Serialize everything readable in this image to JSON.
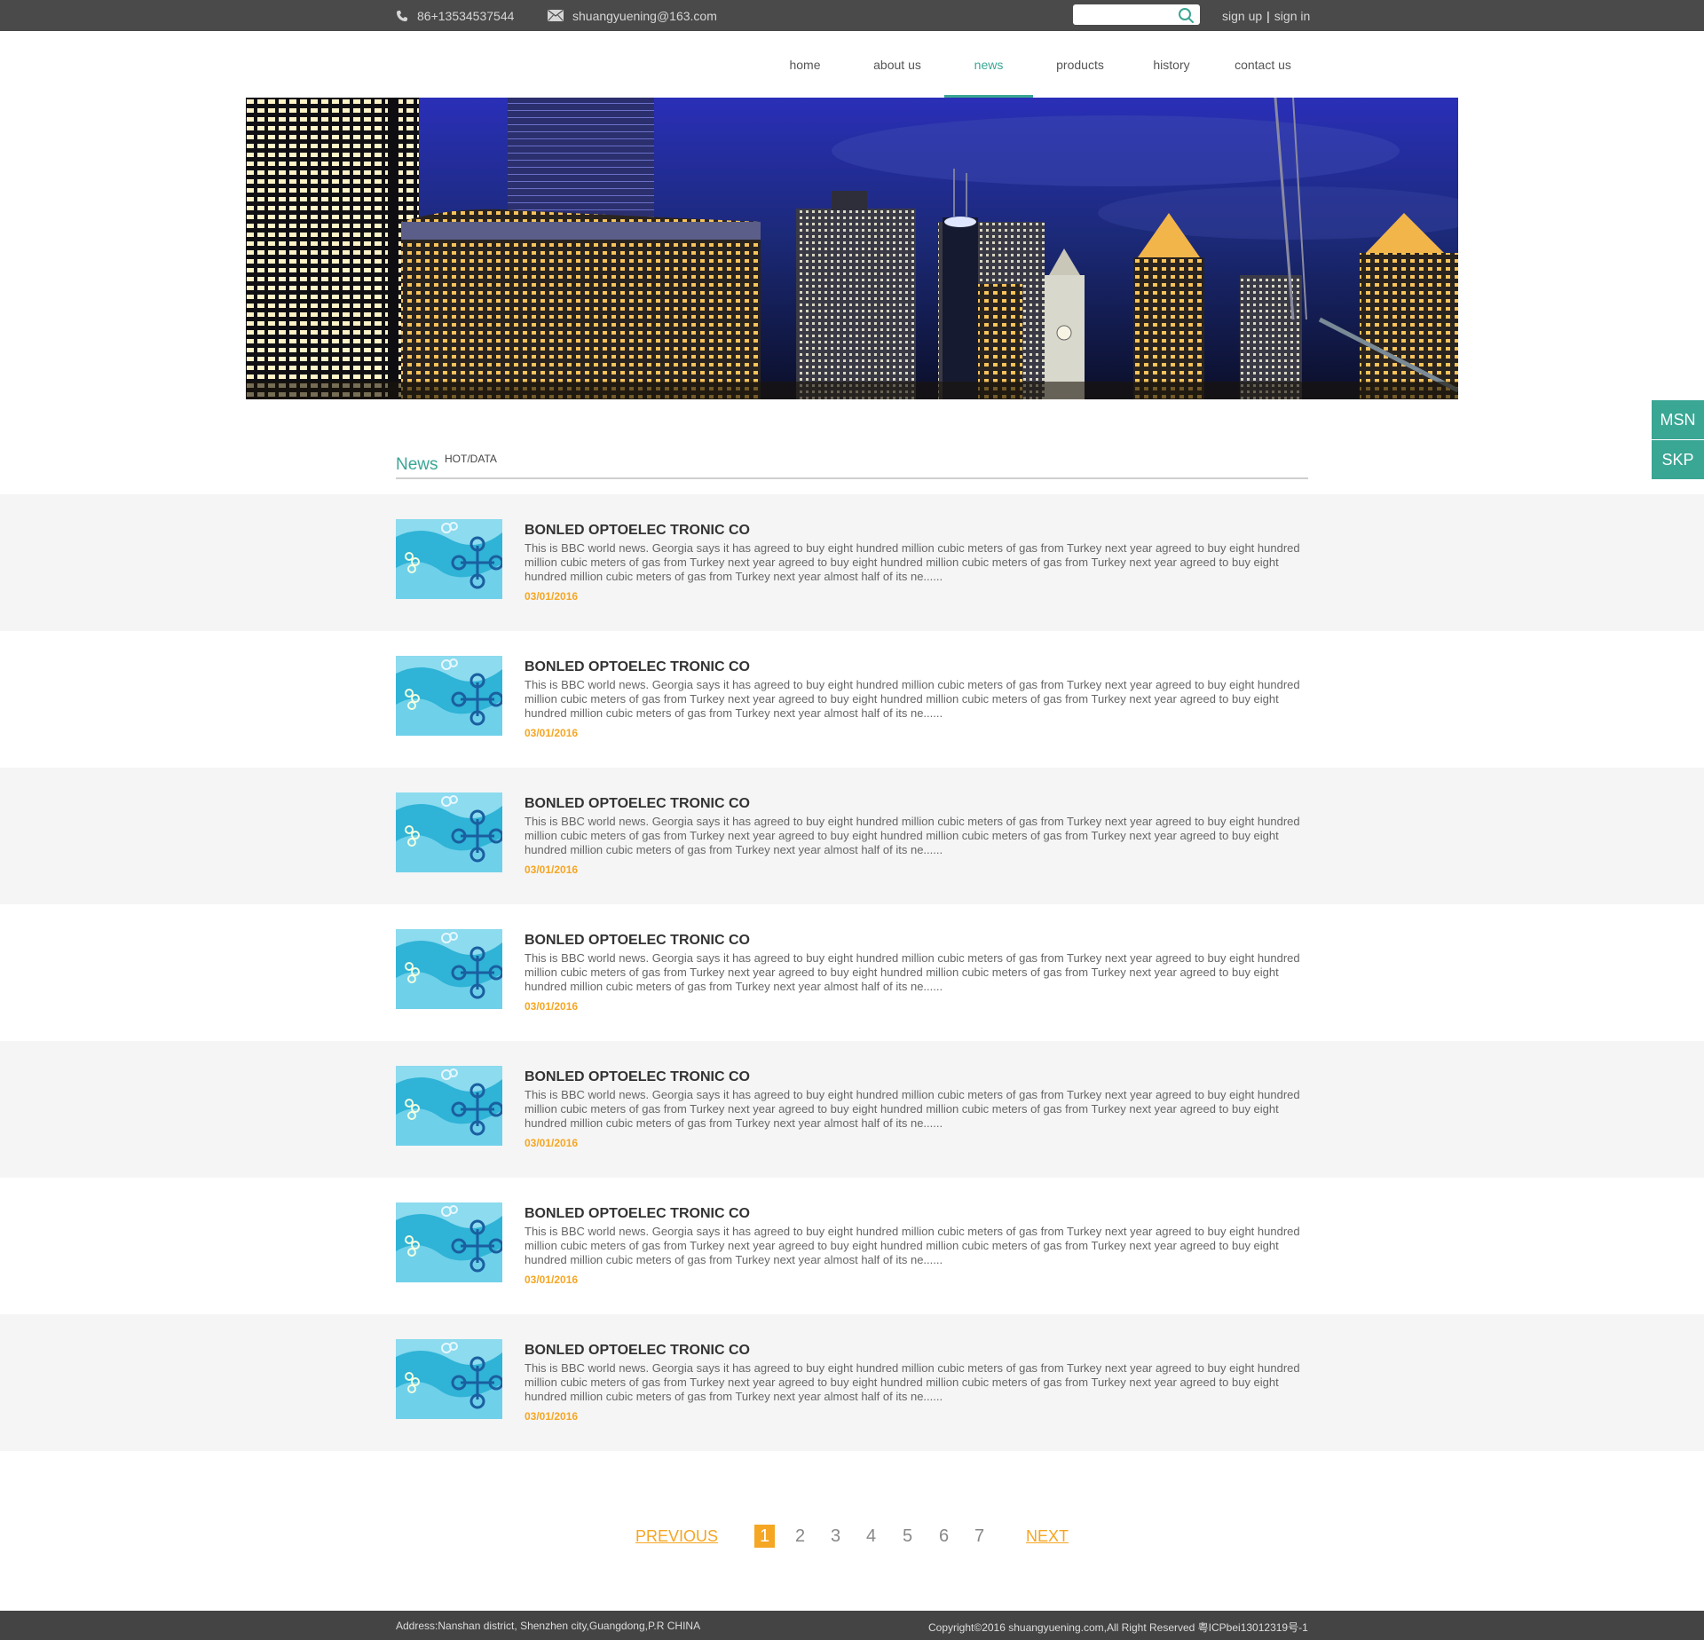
{
  "topbar": {
    "phone": "86+13534537544",
    "email": "shuangyuening@163.com",
    "search_placeholder": "",
    "sign_up": "sign up",
    "separator": "|",
    "sign_in": "sign in"
  },
  "nav": {
    "items": [
      {
        "label": "home"
      },
      {
        "label": "about us"
      },
      {
        "label": "news"
      },
      {
        "label": "products"
      },
      {
        "label": "history"
      },
      {
        "label": "contact us"
      }
    ],
    "active": "news"
  },
  "side_buttons": {
    "msn": "MSN",
    "skp": "SKP"
  },
  "section": {
    "title": "News",
    "subtitle": "HOT/DATA"
  },
  "news": [
    {
      "title": "BONLED OPTOELEC TRONIC CO",
      "desc": "This is BBC world news. Georgia says it has agreed to buy eight hundred million cubic meters of gas from Turkey next year agreed to buy eight hundred million cubic meters of gas from Turkey next year agreed to buy eight hundred million cubic meters of gas from Turkey next year agreed to buy eight hundred million cubic meters of gas from Turkey next year almost half of its ne......",
      "date": "03/01/2016"
    },
    {
      "title": "BONLED OPTOELEC TRONIC CO",
      "desc": "This is BBC world news. Georgia says it has agreed to buy eight hundred million cubic meters of gas from Turkey next year agreed to buy eight hundred million cubic meters of gas from Turkey next year agreed to buy eight hundred million cubic meters of gas from Turkey next year agreed to buy eight hundred million cubic meters of gas from Turkey next year almost half of its ne......",
      "date": "03/01/2016"
    },
    {
      "title": "BONLED OPTOELEC TRONIC CO",
      "desc": "This is BBC world news. Georgia says it has agreed to buy eight hundred million cubic meters of gas from Turkey next year agreed to buy eight hundred million cubic meters of gas from Turkey next year agreed to buy eight hundred million cubic meters of gas from Turkey next year agreed to buy eight hundred million cubic meters of gas from Turkey next year almost half of its ne......",
      "date": "03/01/2016"
    },
    {
      "title": "BONLED OPTOELEC TRONIC CO",
      "desc": "This is BBC world news. Georgia says it has agreed to buy eight hundred million cubic meters of gas from Turkey next year agreed to buy eight hundred million cubic meters of gas from Turkey next year agreed to buy eight hundred million cubic meters of gas from Turkey next year agreed to buy eight hundred million cubic meters of gas from Turkey next year almost half of its ne......",
      "date": "03/01/2016"
    },
    {
      "title": "BONLED OPTOELEC TRONIC CO",
      "desc": "This is BBC world news. Georgia says it has agreed to buy eight hundred million cubic meters of gas from Turkey next year agreed to buy eight hundred million cubic meters of gas from Turkey next year agreed to buy eight hundred million cubic meters of gas from Turkey next year agreed to buy eight hundred million cubic meters of gas from Turkey next year almost half of its ne......",
      "date": "03/01/2016"
    },
    {
      "title": "BONLED OPTOELEC TRONIC CO",
      "desc": "This is BBC world news. Georgia says it has agreed to buy eight hundred million cubic meters of gas from Turkey next year agreed to buy eight hundred million cubic meters of gas from Turkey next year agreed to buy eight hundred million cubic meters of gas from Turkey next year agreed to buy eight hundred million cubic meters of gas from Turkey next year almost half of its ne......",
      "date": "03/01/2016"
    },
    {
      "title": "BONLED OPTOELEC TRONIC CO",
      "desc": "This is BBC world news. Georgia says it has agreed to buy eight hundred million cubic meters of gas from Turkey next year agreed to buy eight hundred million cubic meters of gas from Turkey next year agreed to buy eight hundred million cubic meters of gas from Turkey next year agreed to buy eight hundred million cubic meters of gas from Turkey next year almost half of its ne......",
      "date": "03/01/2016"
    }
  ],
  "pagination": {
    "previous": "PREVIOUS",
    "pages": [
      "1",
      "2",
      "3",
      "4",
      "5",
      "6",
      "7"
    ],
    "current": "1",
    "next": "NEXT"
  },
  "footer": {
    "address": "Address:Nanshan district, Shenzhen city,Guangdong,P.R CHINA",
    "copyright": "Copyright©2016 shuangyuening.com,All Right Reserved 粤ICPbei13012319号-1"
  },
  "colors": {
    "accent": "#3aa694",
    "date": "#f5a623",
    "topbar": "#4a4a4a",
    "footer": "#444444",
    "row_shade": "#f5f5f5"
  },
  "icons": {
    "phone": "phone-icon",
    "email": "envelope-icon",
    "search": "search-icon"
  }
}
